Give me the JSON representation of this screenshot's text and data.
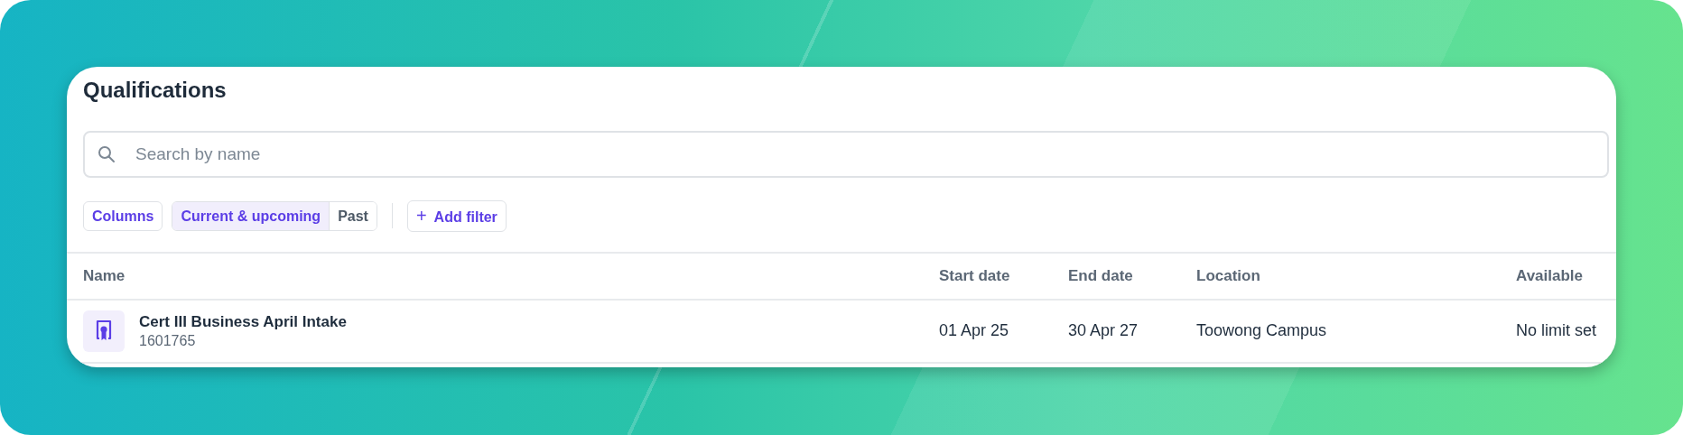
{
  "title": "Qualifications",
  "search": {
    "placeholder": "Search by name"
  },
  "columns_button": "Columns",
  "period_options": [
    {
      "label": "Current & upcoming",
      "selected": true
    },
    {
      "label": "Past",
      "selected": false
    }
  ],
  "add_filter": {
    "icon": "+",
    "label": "Add filter"
  },
  "table": {
    "columns": [
      "Name",
      "Start date",
      "End date",
      "Location",
      "Available"
    ],
    "rows": [
      {
        "name": "Cert III Business April Intake",
        "code": "1601765",
        "start_date": "01 Apr 25",
        "end_date": "30 Apr 27",
        "location": "Toowong Campus",
        "available": "No limit set"
      }
    ]
  }
}
